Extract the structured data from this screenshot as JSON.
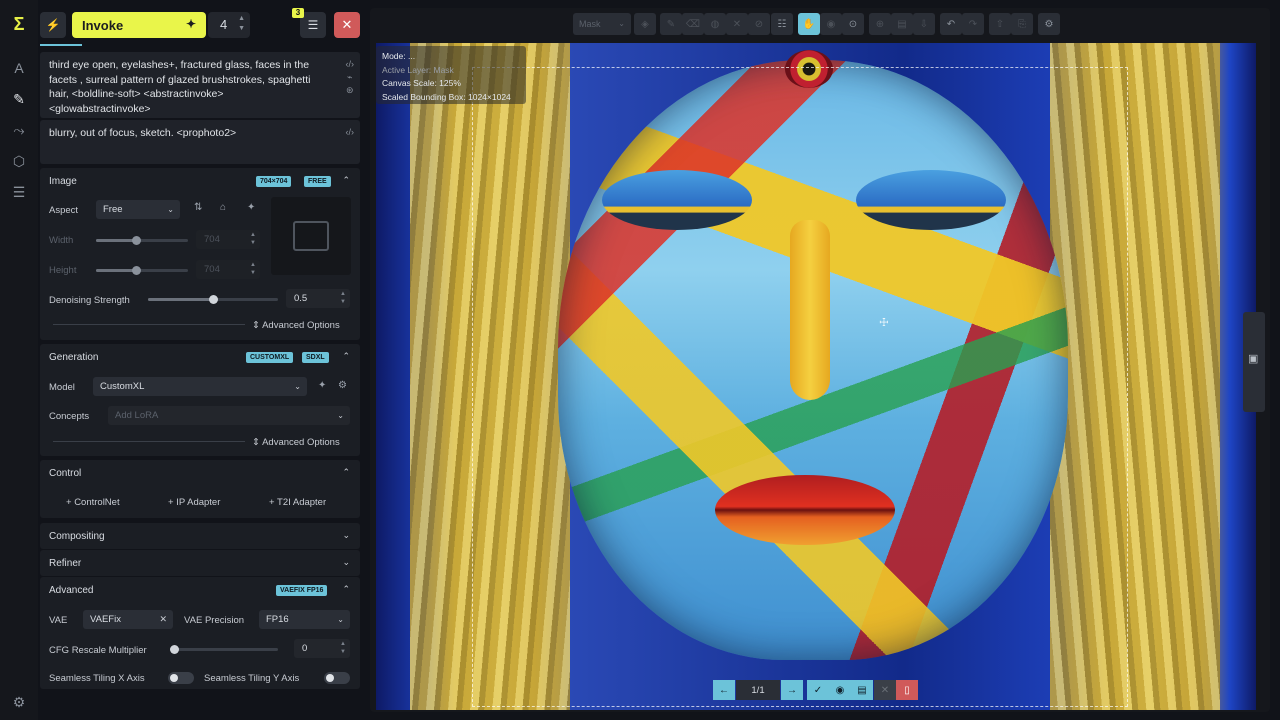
{
  "rail": {
    "logo_glyph": "Σ",
    "icons": [
      {
        "name": "text-to-image-icon",
        "glyph": "A"
      },
      {
        "name": "canvas-brush-icon",
        "glyph": "✎"
      },
      {
        "name": "workflow-icon",
        "glyph": "⤳"
      },
      {
        "name": "models-cube-icon",
        "glyph": "⬡"
      },
      {
        "name": "queue-list-icon",
        "glyph": "☰"
      }
    ],
    "settings_glyph": "⚙"
  },
  "topbar": {
    "invoke_label": "Invoke",
    "iterations": "4",
    "queue_count": "3",
    "queue_glyph": "☰",
    "cancel_glyph": "✕",
    "bolt_glyph": "⚡"
  },
  "prompts": {
    "positive": "third eye open, eyelashes+, fractured glass, faces in the facets , surreal pattern of glazed brushstrokes, spaghetti hair, <boldline-soft> <abstractinvoke> <glowabstractinvoke>",
    "negative": "blurry, out of focus, sketch. <prophoto2>"
  },
  "image_section": {
    "title": "Image",
    "badges": [
      "704×704",
      "FREE"
    ],
    "aspect_label": "Aspect",
    "aspect_value": "Free",
    "width_label": "Width",
    "width_value": "704",
    "height_label": "Height",
    "height_value": "704",
    "denoise_label": "Denoising Strength",
    "denoise_value": "0.5",
    "denoise_level": 0.5,
    "advanced_label": "Advanced Options"
  },
  "generation_section": {
    "title": "Generation",
    "badges": [
      "CUSTOMXL",
      "SDXL"
    ],
    "model_label": "Model",
    "model_value": "CustomXL",
    "concepts_label": "Concepts",
    "concepts_placeholder": "Add LoRA",
    "advanced_label": "Advanced Options"
  },
  "control_section": {
    "title": "Control",
    "buttons": [
      "ControlNet",
      "IP Adapter",
      "T2I Adapter"
    ]
  },
  "collapsed_sections": [
    "Compositing",
    "Refiner"
  ],
  "advanced_section": {
    "title": "Advanced",
    "badge": "VAEFIX FP16",
    "vae_label": "VAE",
    "vae_value": "VAEFix",
    "vae_precision_label": "VAE Precision",
    "vae_precision_value": "FP16",
    "cfg_label": "CFG Rescale Multiplier",
    "cfg_value": "0",
    "tiling_x_label": "Seamless Tiling X Axis",
    "tiling_y_label": "Seamless Tiling Y Axis"
  },
  "canvas": {
    "layer_select": "Mask",
    "overlay": {
      "mode": "Mode: ...",
      "active_layer": "Active Layer: Mask",
      "scale": "Canvas Scale: 125%",
      "bbox": "Scaled Bounding Box: 1024×1024"
    },
    "staging_count": "1/1"
  },
  "colors": {
    "accent_yellow": "#e9f54a",
    "accent_cyan": "#6cc3d9",
    "danger_red": "#d05a5a"
  }
}
